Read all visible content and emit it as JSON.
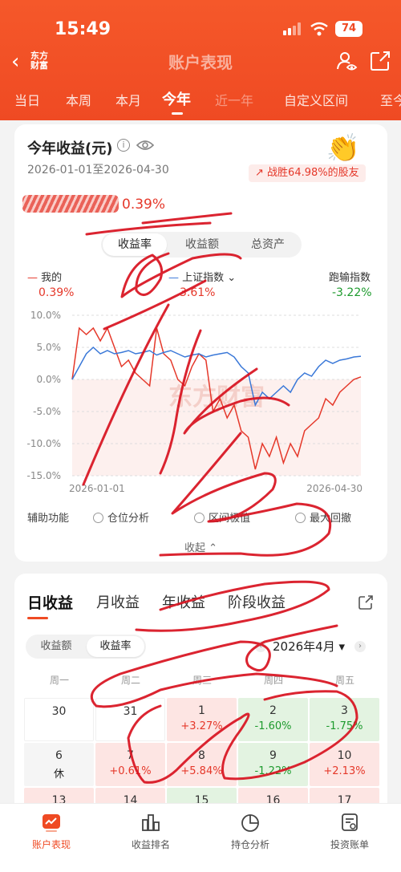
{
  "status_bar": {
    "time": "15:49",
    "battery": "74"
  },
  "nav": {
    "logo": "东方财富",
    "title": "账户表现"
  },
  "tabs": [
    "当日",
    "本周",
    "本月",
    "今年",
    "近一年",
    "自定义区间",
    "至今"
  ],
  "active_tab": "今年",
  "card": {
    "title": "今年收益(元)",
    "date_range": "2026-01-01至2026-04-30",
    "beat_text": "战胜64.98%的股友",
    "return_pct": "0.39%",
    "segments": [
      "收益率",
      "收益额",
      "总资产"
    ],
    "legend": [
      {
        "label": "我的",
        "value": "0.39%",
        "color": "#e5382a"
      },
      {
        "label": "上证指数",
        "value": "3.61%",
        "color": "#3a78d8"
      },
      {
        "label": "跑输指数",
        "value": "-3.22%",
        "color": "#1d9a2d"
      }
    ],
    "watermark": "东方财富",
    "aux_label": "辅助功能",
    "aux_options": [
      "仓位分析",
      "区间极值",
      "最大回撤"
    ],
    "collapse_label": "收起"
  },
  "chart_data": {
    "type": "line",
    "x_start": "2026-01-01",
    "x_end": "2026-04-30",
    "y_ticks": [
      "10.0%",
      "5.0%",
      "0.0%",
      "-5.0%",
      "-10.0%",
      "-15.0%"
    ],
    "ylim": [
      -15,
      10
    ],
    "series": [
      {
        "name": "我的",
        "color": "#e5382a",
        "values": [
          0,
          8,
          7,
          8,
          6,
          8,
          5,
          2,
          3,
          1,
          0,
          -1,
          8,
          4,
          3,
          0,
          -1,
          2,
          4,
          3,
          -5,
          -3,
          -6,
          -4,
          -8,
          -9,
          -14,
          -10,
          -12,
          -9,
          -13,
          -10,
          -12,
          -8,
          -7,
          -6,
          -3,
          -4,
          -2,
          -1,
          0,
          0.4
        ]
      },
      {
        "name": "上证指数",
        "color": "#3a78d8",
        "values": [
          0,
          2,
          4,
          5,
          4,
          4.5,
          4,
          4.2,
          4.5,
          4,
          4.2,
          4.5,
          3.8,
          4.2,
          4.5,
          4,
          3.5,
          3.8,
          4,
          3.5,
          3.8,
          4,
          4.2,
          3.5,
          2,
          1,
          -4,
          -2,
          -3,
          -2,
          -1,
          -2,
          0,
          1,
          0.5,
          2,
          3,
          2.5,
          3,
          3.2,
          3.5,
          3.61
        ]
      }
    ]
  },
  "daily": {
    "tabs": [
      "日收益",
      "月收益",
      "年收益",
      "阶段收益"
    ],
    "segments": [
      "收益额",
      "收益率"
    ],
    "month": "2026年4月",
    "weekdays": [
      "周一",
      "周二",
      "周三",
      "周四",
      "周五"
    ],
    "rows": [
      [
        {
          "d": "30",
          "v": "",
          "c": "plain"
        },
        {
          "d": "31",
          "v": "",
          "c": "plain"
        },
        {
          "d": "1",
          "v": "+3.27%",
          "c": "red"
        },
        {
          "d": "2",
          "v": "-1.60%",
          "c": "green"
        },
        {
          "d": "3",
          "v": "-1.75%",
          "c": "green"
        }
      ],
      [
        {
          "d": "6",
          "v": "休",
          "c": "grey"
        },
        {
          "d": "7",
          "v": "+0.61%",
          "c": "red"
        },
        {
          "d": "8",
          "v": "+5.84%",
          "c": "red"
        },
        {
          "d": "9",
          "v": "-1.22%",
          "c": "green"
        },
        {
          "d": "10",
          "v": "+2.13%",
          "c": "red"
        }
      ],
      [
        {
          "d": "13",
          "v": "",
          "c": "red"
        },
        {
          "d": "14",
          "v": "",
          "c": "red"
        },
        {
          "d": "15",
          "v": "",
          "c": "green"
        },
        {
          "d": "16",
          "v": "",
          "c": "red"
        },
        {
          "d": "17",
          "v": "",
          "c": "red"
        }
      ]
    ]
  },
  "bottom_nav": [
    {
      "label": "账户表现",
      "icon": "chart-card-icon",
      "active": true
    },
    {
      "label": "收益排名",
      "icon": "bar-rank-icon",
      "active": false
    },
    {
      "label": "持仓分析",
      "icon": "pie-icon",
      "active": false
    },
    {
      "label": "投资账单",
      "icon": "bill-icon",
      "active": false
    }
  ]
}
